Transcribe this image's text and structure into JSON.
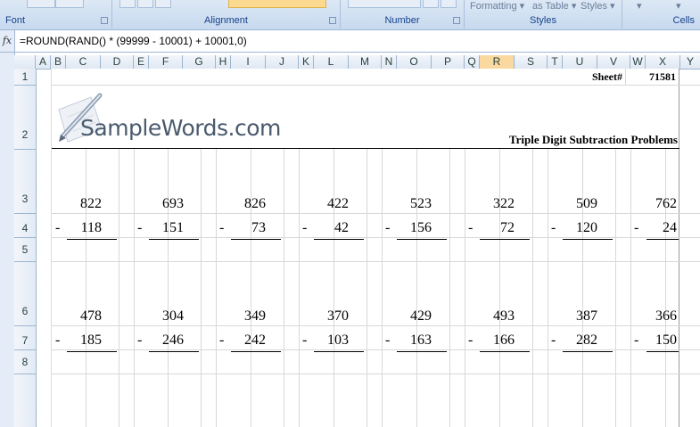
{
  "ribbon": {
    "groups": [
      {
        "name": "font",
        "label": "Font"
      },
      {
        "name": "alignment",
        "label": "Alignment"
      },
      {
        "name": "number",
        "label": "Number"
      },
      {
        "name": "styles",
        "label": "Styles"
      },
      {
        "name": "cells",
        "label": "Cells"
      }
    ],
    "styles_buttons": {
      "conditional_formatting": "Formatting",
      "format_as_table": "as Table",
      "cell_styles": "Styles"
    }
  },
  "formula_bar": {
    "fx_label": "fx",
    "formula": "=ROUND(RAND() * (99999 - 10001) + 10001,0)"
  },
  "columns": [
    "A",
    "B",
    "C",
    "D",
    "E",
    "F",
    "G",
    "H",
    "I",
    "J",
    "K",
    "L",
    "M",
    "N",
    "O",
    "P",
    "Q",
    "R",
    "S",
    "T",
    "U",
    "V",
    "W",
    "X",
    "Y"
  ],
  "selected_column": "R",
  "rows": [
    "1",
    "2",
    "3",
    "4",
    "5",
    "6",
    "7",
    "8"
  ],
  "sheet": {
    "sheet_label": "Sheet#",
    "sheet_number": "71581",
    "logo_text": "SampleWords.com",
    "title": "Triple Digit Subtraction Problems",
    "operator": "-",
    "problems_row1": [
      {
        "top": "822",
        "bottom": "118"
      },
      {
        "top": "693",
        "bottom": "151"
      },
      {
        "top": "826",
        "bottom": "73"
      },
      {
        "top": "422",
        "bottom": "42"
      },
      {
        "top": "523",
        "bottom": "156"
      },
      {
        "top": "322",
        "bottom": "72"
      },
      {
        "top": "509",
        "bottom": "120"
      },
      {
        "top": "762",
        "bottom": "24"
      }
    ],
    "problems_row2": [
      {
        "top": "478",
        "bottom": "185"
      },
      {
        "top": "304",
        "bottom": "246"
      },
      {
        "top": "349",
        "bottom": "242"
      },
      {
        "top": "370",
        "bottom": "103"
      },
      {
        "top": "429",
        "bottom": "163"
      },
      {
        "top": "493",
        "bottom": "166"
      },
      {
        "top": "387",
        "bottom": "282"
      },
      {
        "top": "366",
        "bottom": "150"
      }
    ]
  }
}
